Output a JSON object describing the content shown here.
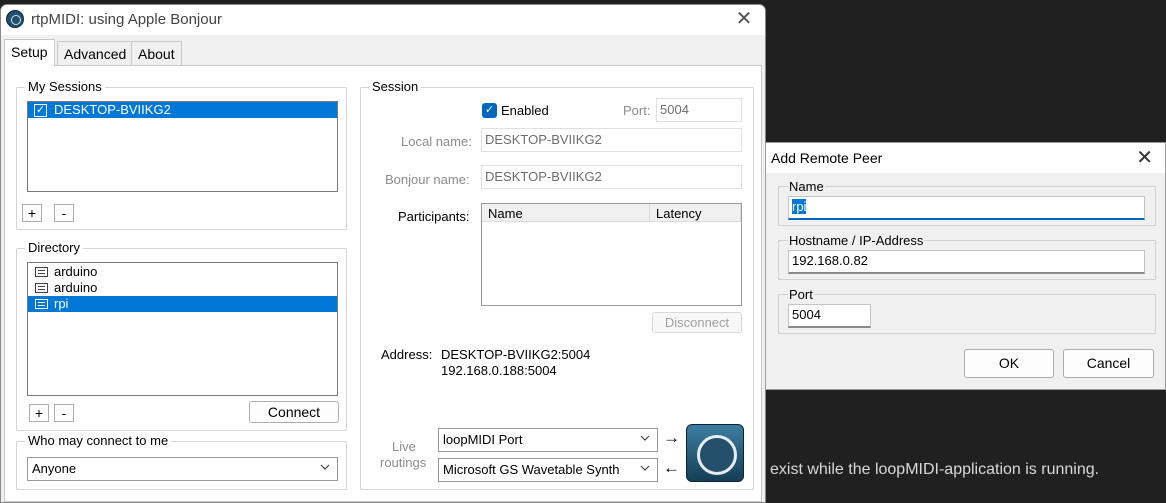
{
  "main_window": {
    "title": "rtpMIDI: using Apple Bonjour",
    "close_glyph": "✕",
    "tabs": [
      "Setup",
      "Advanced",
      "About"
    ],
    "my_sessions": {
      "title": "My Sessions",
      "items": [
        "DESKTOP-BVIIKG2"
      ],
      "add_label": "+",
      "remove_label": "-"
    },
    "directory": {
      "title": "Directory",
      "items": [
        "arduino",
        "arduino",
        "rpi"
      ],
      "add_label": "+",
      "remove_label": "-",
      "connect_label": "Connect"
    },
    "who_may_connect": {
      "title": "Who may connect to me",
      "value": "Anyone"
    },
    "session": {
      "title": "Session",
      "enabled_label": "Enabled",
      "port_label": "Port:",
      "port_value": "5004",
      "local_name_label": "Local name:",
      "local_name_value": "DESKTOP-BVIIKG2",
      "bonjour_name_label": "Bonjour name:",
      "bonjour_name_value": "DESKTOP-BVIIKG2",
      "participants_label": "Participants:",
      "col_name": "Name",
      "col_latency": "Latency",
      "disconnect_label": "Disconnect",
      "address_label": "Address:",
      "address_line1": "DESKTOP-BVIIKG2:5004",
      "address_line2": "192.168.0.188:5004",
      "live_label1": "Live",
      "live_label2": "routings",
      "routing_in": "loopMIDI Port",
      "routing_out": "Microsoft GS Wavetable Synth",
      "arrow_right": "→",
      "arrow_left": "←"
    }
  },
  "dialog": {
    "title": "Add Remote Peer",
    "close_glyph": "✕",
    "name_label": "Name",
    "name_value": "rpi",
    "host_label": "Hostname / IP-Address",
    "host_value": "192.168.0.82",
    "port_label": "Port",
    "port_value": "5004",
    "ok_label": "OK",
    "cancel_label": "Cancel"
  },
  "background_text": "exist while the loopMIDI-application is running.",
  "colors": {
    "selection": "#0078d7",
    "checkbox": "#0067c0",
    "desktop": "#202020"
  }
}
